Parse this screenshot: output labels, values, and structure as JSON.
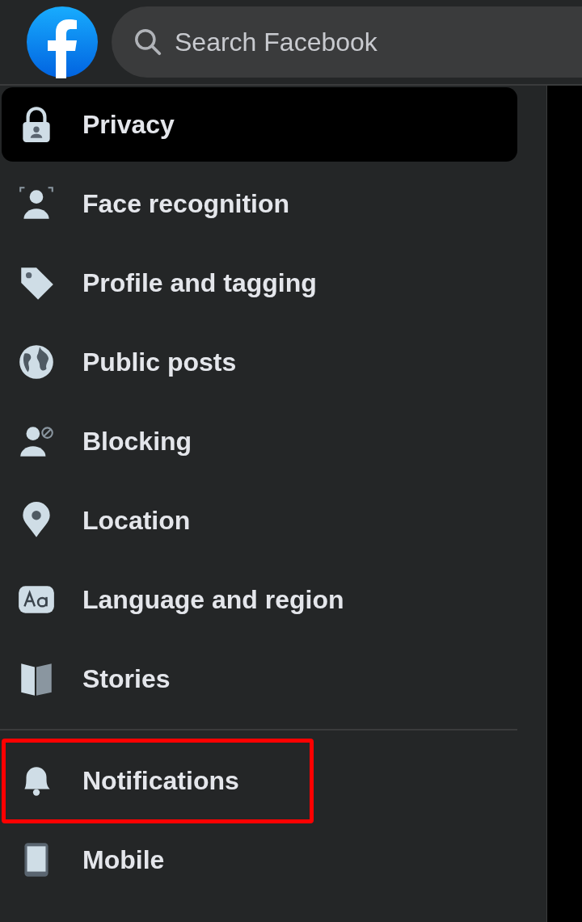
{
  "search": {
    "placeholder": "Search Facebook"
  },
  "sections": [
    {
      "items": [
        {
          "label": "Privacy",
          "selected": true,
          "highlighted": false
        },
        {
          "label": "Face recognition",
          "selected": false,
          "highlighted": false
        },
        {
          "label": "Profile and tagging",
          "selected": false,
          "highlighted": false
        },
        {
          "label": "Public posts",
          "selected": false,
          "highlighted": false
        },
        {
          "label": "Blocking",
          "selected": false,
          "highlighted": false
        },
        {
          "label": "Location",
          "selected": false,
          "highlighted": false
        },
        {
          "label": "Language and region",
          "selected": false,
          "highlighted": false
        },
        {
          "label": "Stories",
          "selected": false,
          "highlighted": false
        }
      ]
    },
    {
      "items": [
        {
          "label": "Notifications",
          "selected": false,
          "highlighted": true
        },
        {
          "label": "Mobile",
          "selected": false,
          "highlighted": false
        }
      ]
    }
  ]
}
